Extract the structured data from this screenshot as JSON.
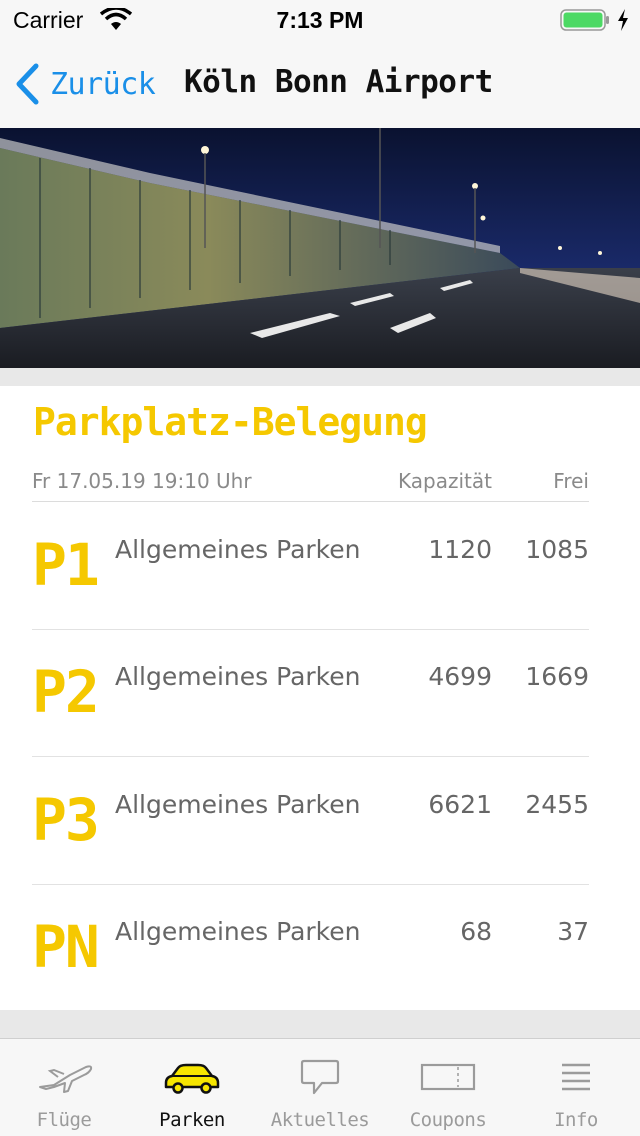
{
  "status_bar": {
    "carrier": "Carrier",
    "time": "7:13 PM",
    "battery_color": "#4cd964"
  },
  "nav": {
    "back_label": "Zurück",
    "title": "Köln Bonn Airport",
    "accent_color": "#1a8fe8"
  },
  "hero": {
    "icon": "airport-parking-garage-night-photo"
  },
  "parking": {
    "title": "Parkplatz-Belegung",
    "timestamp": "Fr 17.05.19 19:10 Uhr",
    "col_capacity": "Kapazität",
    "col_free": "Frei",
    "accent_color": "#f5c800",
    "rows": [
      {
        "code": "P1",
        "name": "Allgemeines Parken",
        "capacity": "1120",
        "free": "1085"
      },
      {
        "code": "P2",
        "name": "Allgemeines Parken",
        "capacity": "4699",
        "free": "1669"
      },
      {
        "code": "P3",
        "name": "Allgemeines Parken",
        "capacity": "6621",
        "free": "2455"
      },
      {
        "code": "PN",
        "name": "Allgemeines Parken",
        "capacity": "68",
        "free": "37"
      }
    ]
  },
  "tabs": [
    {
      "label": "Flüge",
      "icon": "airplane-icon",
      "active": false
    },
    {
      "label": "Parken",
      "icon": "car-icon",
      "active": true
    },
    {
      "label": "Aktuelles",
      "icon": "speech-bubble-icon",
      "active": false
    },
    {
      "label": "Coupons",
      "icon": "ticket-icon",
      "active": false
    },
    {
      "label": "Info",
      "icon": "menu-lines-icon",
      "active": false
    }
  ]
}
